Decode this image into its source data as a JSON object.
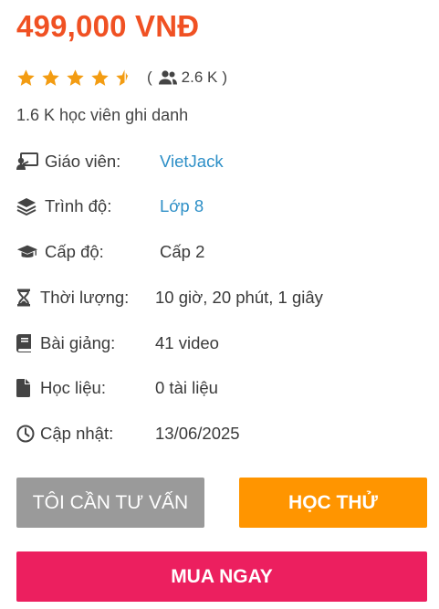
{
  "price": "499,000 VNĐ",
  "rating": {
    "stars": 4.5,
    "open_paren": "(",
    "reviews_count": "2.6 K",
    "close_paren": ")"
  },
  "enrolled": "1.6 K học viên ghi danh",
  "info": {
    "teacher": {
      "label": "Giáo viên:",
      "value": "VietJack",
      "icon": "teacher-icon"
    },
    "grade": {
      "label": "Trình độ:",
      "value": "Lớp 8",
      "icon": "layers-icon"
    },
    "level": {
      "label": "Cấp độ:",
      "value": "Cấp 2",
      "icon": "graduation-cap-icon"
    },
    "duration": {
      "label": "Thời lượng:",
      "value": "10 giờ, 20 phút, 1 giây",
      "icon": "hourglass-icon"
    },
    "lessons": {
      "label": "Bài giảng:",
      "value": "41 video",
      "icon": "book-icon"
    },
    "materials": {
      "label": "Học liệu:",
      "value": "0 tài liệu",
      "icon": "file-icon"
    },
    "updated": {
      "label": "Cập nhật:",
      "value": "13/06/2025",
      "icon": "clock-icon"
    }
  },
  "buttons": {
    "consult": "TÔI CẦN TƯ VẤN",
    "trial": "HỌC THỬ",
    "buy": "MUA NGAY"
  },
  "colors": {
    "price": "#f05123",
    "star": "#f39c12",
    "link": "#2d8fc7",
    "consult_bg": "#9a9a9a",
    "trial_bg": "#ff9500",
    "buy_bg": "#ec1f5f"
  }
}
